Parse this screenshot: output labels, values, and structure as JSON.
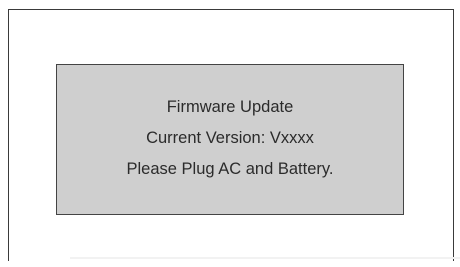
{
  "dialog": {
    "title": "Firmware Update",
    "version_text": "Current Version: Vxxxx",
    "instruction_text": "Please Plug AC and Battery."
  }
}
